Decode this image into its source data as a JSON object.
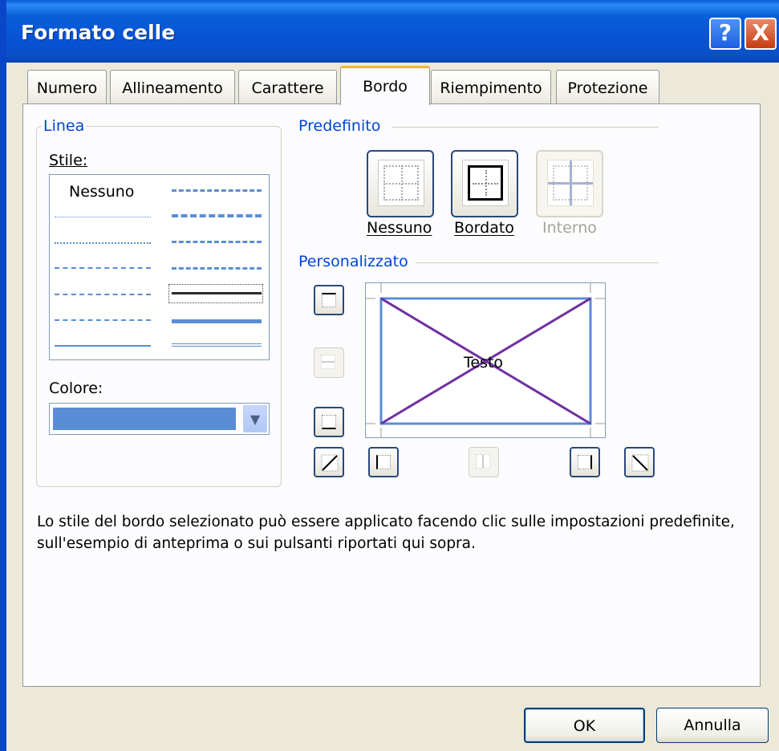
{
  "window": {
    "title": "Formato celle"
  },
  "title_buttons": {
    "help": "?",
    "close": "X"
  },
  "tabs": [
    {
      "label": "Numero"
    },
    {
      "label": "Allineamento"
    },
    {
      "label": "Carattere"
    },
    {
      "label": "Bordo",
      "active": true
    },
    {
      "label": "Riempimento"
    },
    {
      "label": "Protezione"
    }
  ],
  "linea": {
    "group_label": "Linea",
    "style_label": "Stile:",
    "none_label": "Nessuno",
    "color_label": "Colore:",
    "color_value": "#5b8dd6"
  },
  "predefinito": {
    "group_label": "Predefinito",
    "buttons": [
      {
        "label": "Nessuno",
        "enabled": true
      },
      {
        "label": "Bordato",
        "enabled": true
      },
      {
        "label": "Interno",
        "enabled": false
      }
    ]
  },
  "personalizzato": {
    "group_label": "Personalizzato",
    "preview_text": "Testo",
    "line_color": "#5b8dd6",
    "diagonal_color": "#7030a0"
  },
  "description": "Lo stile del bordo selezionato può essere applicato facendo clic sulle impostazioni predefinite, sull'esempio di anteprima o sui pulsanti riportati qui sopra.",
  "buttons": {
    "ok": "OK",
    "cancel": "Annulla"
  }
}
